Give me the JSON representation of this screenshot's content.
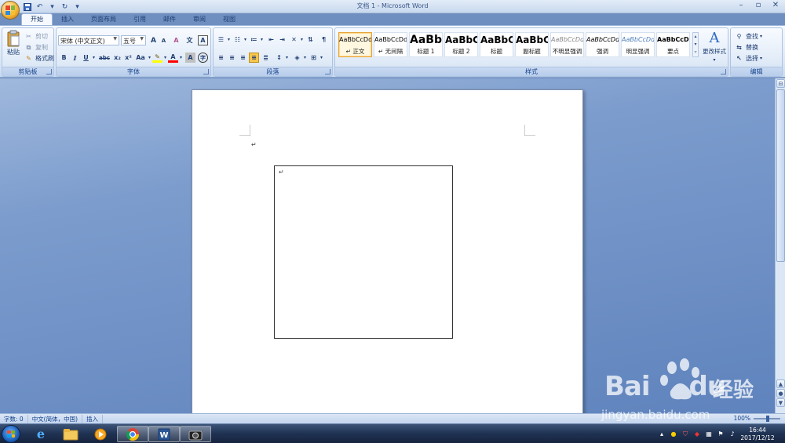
{
  "window": {
    "title": "文档 1 - Microsoft Word",
    "qat_dropdown": "▾"
  },
  "tabs": [
    {
      "label": "开始",
      "active": true
    },
    {
      "label": "插入"
    },
    {
      "label": "页面布局"
    },
    {
      "label": "引用"
    },
    {
      "label": "邮件"
    },
    {
      "label": "审阅"
    },
    {
      "label": "视图"
    }
  ],
  "clipboard": {
    "group_label": "剪贴板",
    "paste": "粘贴",
    "cut": "剪切",
    "copy": "复制",
    "format_painter": "格式刷"
  },
  "font": {
    "group_label": "字体",
    "font_name": "宋体 (中文正文)",
    "font_size": "五号",
    "bold": "B",
    "italic": "I",
    "underline": "U",
    "strike": "abc",
    "subscript": "x₂",
    "superscript": "x²",
    "change_case": "Aa",
    "grow": "A",
    "shrink": "A",
    "clear": "A",
    "phonetic": "文",
    "border_char": "A",
    "font_color": "A",
    "char_shading": "A",
    "enclose": "字"
  },
  "paragraph": {
    "group_label": "段落"
  },
  "styles": {
    "group_label": "样式",
    "change_styles": "更改样式",
    "items": [
      {
        "sample": "AaBbCcDd",
        "name": "↵ 正文",
        "selected": true
      },
      {
        "sample": "AaBbCcDd",
        "name": "↵ 无间隔"
      },
      {
        "sample": "AaBb",
        "name": "标题 1"
      },
      {
        "sample": "AaBbC",
        "name": "标题 2"
      },
      {
        "sample": "AaBbC",
        "name": "标题"
      },
      {
        "sample": "AaBbC",
        "name": "副标题"
      },
      {
        "sample": "AaBbCcDd",
        "name": "不明显强调"
      },
      {
        "sample": "AaBbCcDd",
        "name": "强调"
      },
      {
        "sample": "AaBbCcDd",
        "name": "明显强调"
      },
      {
        "sample": "AaBbCcDd",
        "name": "要点"
      }
    ]
  },
  "editing": {
    "group_label": "编辑",
    "find": "查找",
    "replace": "替换",
    "select": "选择"
  },
  "document": {
    "para_mark": "↵",
    "textbox_para_mark": "↵"
  },
  "statusbar": {
    "word_count": "字数: 0",
    "language": "中文(简体，中国)",
    "insert_mode": "插入",
    "zoom": "100%"
  },
  "taskbar": {
    "time": "16:44",
    "date": "2017/12/12"
  },
  "watermark": {
    "brand": "Bai",
    "brand2": "du",
    "cn": "经验",
    "url": "jingyan.baidu.com"
  },
  "colors": {
    "accent": "#15428b",
    "highlight": "#ffff00",
    "font_color": "#ff0000"
  }
}
